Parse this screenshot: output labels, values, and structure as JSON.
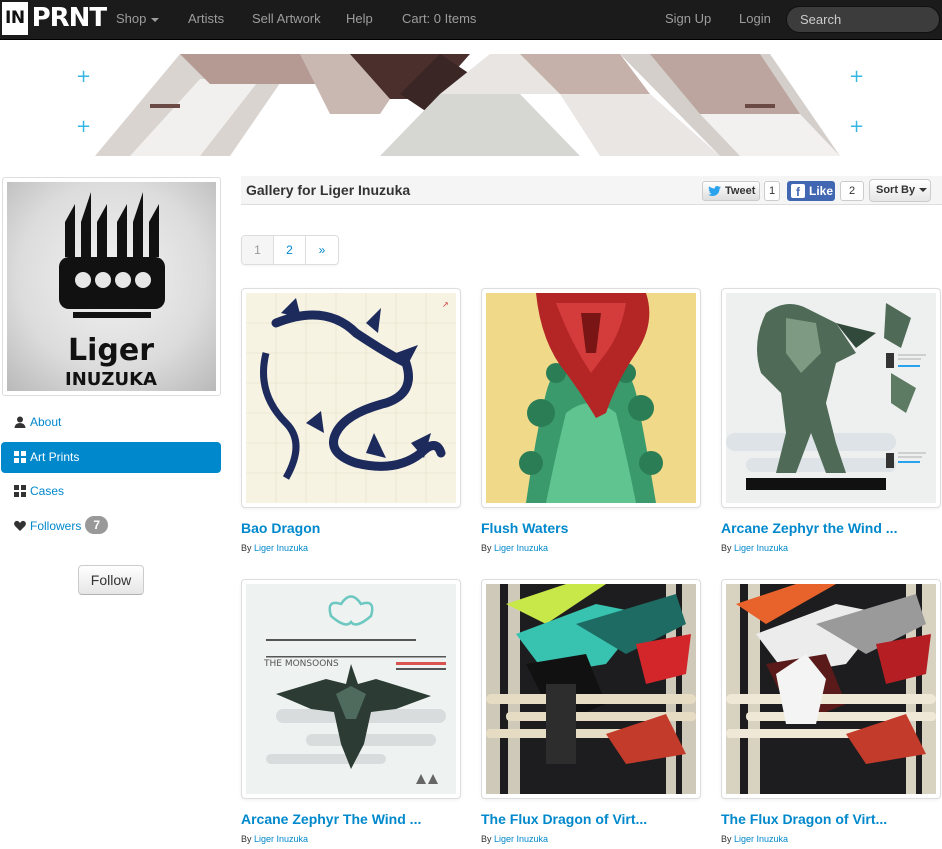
{
  "brand": {
    "logo_in": "IN",
    "logo_prnt": "PRNT"
  },
  "nav": {
    "shop": "Shop",
    "artists": "Artists",
    "sell": "Sell Artwork",
    "help": "Help",
    "cart": "Cart: 0 Items",
    "signup": "Sign Up",
    "login": "Login",
    "search_placeholder": "Search"
  },
  "sidebar": {
    "avatar_text_top": "Liger",
    "avatar_text_bottom": "INUZUKA",
    "items": [
      {
        "label": "About",
        "icon": "user-icon"
      },
      {
        "label": "Art Prints",
        "icon": "grid-icon"
      },
      {
        "label": "Cases",
        "icon": "grid-icon"
      },
      {
        "label": "Followers",
        "icon": "heart-icon"
      }
    ],
    "followers_count": "7",
    "follow_label": "Follow"
  },
  "gallery": {
    "title": "Gallery for Liger Inuzuka",
    "tweet_label": "Tweet",
    "tweet_count": "1",
    "like_label": "Like",
    "like_count": "2",
    "sort_label": "Sort By"
  },
  "pagination": [
    "1",
    "2",
    "»"
  ],
  "artworks": [
    {
      "title": "Bao Dragon",
      "by": "By",
      "artist": "Liger Inuzuka"
    },
    {
      "title": "Flush Waters",
      "by": "By",
      "artist": "Liger Inuzuka"
    },
    {
      "title": "Arcane Zephyr the Wind ...",
      "by": "By",
      "artist": "Liger Inuzuka"
    },
    {
      "title": "Arcane Zephyr The Wind ...",
      "by": "By",
      "artist": "Liger Inuzuka"
    },
    {
      "title": "The Flux Dragon of Virt...",
      "by": "By",
      "artist": "Liger Inuzuka"
    },
    {
      "title": "The Flux Dragon of Virt...",
      "by": "By",
      "artist": "Liger Inuzuka"
    }
  ],
  "colors": {
    "navbar": "#1b1b1b",
    "accent": "#0088cc",
    "facebook": "#4267b2"
  }
}
